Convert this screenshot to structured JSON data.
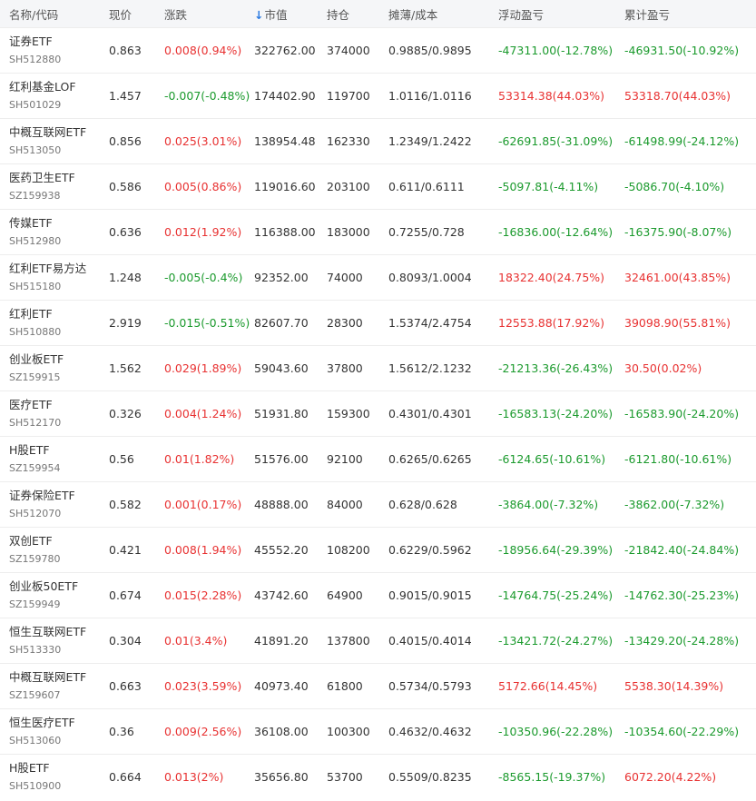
{
  "colors": {
    "up": "#e83232",
    "down": "#1b9a2d",
    "accent": "#2a7ae2"
  },
  "header": {
    "name_code": "名称/代码",
    "price": "现价",
    "change": "涨跌",
    "sort_icon": "arrow-down-icon",
    "sort_arrow": "↓",
    "market_value": "市值",
    "holding": "持仓",
    "cost": "摊薄/成本",
    "floating_pl": "浮动盈亏",
    "total_pl": "累计盈亏"
  },
  "rows": [
    {
      "name": "证券ETF",
      "code": "SH512880",
      "price": "0.863",
      "change": "0.008(0.94%)",
      "change_dir": "up",
      "mv": "322762.00",
      "hold": "374000",
      "cost": "0.9885/0.9895",
      "float": "-47311.00(-12.78%)",
      "float_dir": "down",
      "total": "-46931.50(-10.92%)",
      "total_dir": "down"
    },
    {
      "name": "红利基金LOF",
      "code": "SH501029",
      "price": "1.457",
      "change": "-0.007(-0.48%)",
      "change_dir": "down",
      "mv": "174402.90",
      "hold": "119700",
      "cost": "1.0116/1.0116",
      "float": "53314.38(44.03%)",
      "float_dir": "up",
      "total": "53318.70(44.03%)",
      "total_dir": "up"
    },
    {
      "name": "中概互联网ETF",
      "code": "SH513050",
      "price": "0.856",
      "change": "0.025(3.01%)",
      "change_dir": "up",
      "mv": "138954.48",
      "hold": "162330",
      "cost": "1.2349/1.2422",
      "float": "-62691.85(-31.09%)",
      "float_dir": "down",
      "total": "-61498.99(-24.12%)",
      "total_dir": "down"
    },
    {
      "name": "医药卫生ETF",
      "code": "SZ159938",
      "price": "0.586",
      "change": "0.005(0.86%)",
      "change_dir": "up",
      "mv": "119016.60",
      "hold": "203100",
      "cost": "0.611/0.6111",
      "float": "-5097.81(-4.11%)",
      "float_dir": "down",
      "total": "-5086.70(-4.10%)",
      "total_dir": "down"
    },
    {
      "name": "传媒ETF",
      "code": "SH512980",
      "price": "0.636",
      "change": "0.012(1.92%)",
      "change_dir": "up",
      "mv": "116388.00",
      "hold": "183000",
      "cost": "0.7255/0.728",
      "float": "-16836.00(-12.64%)",
      "float_dir": "down",
      "total": "-16375.90(-8.07%)",
      "total_dir": "down"
    },
    {
      "name": "红利ETF易方达",
      "code": "SH515180",
      "price": "1.248",
      "change": "-0.005(-0.4%)",
      "change_dir": "down",
      "mv": "92352.00",
      "hold": "74000",
      "cost": "0.8093/1.0004",
      "float": "18322.40(24.75%)",
      "float_dir": "up",
      "total": "32461.00(43.85%)",
      "total_dir": "up"
    },
    {
      "name": "红利ETF",
      "code": "SH510880",
      "price": "2.919",
      "change": "-0.015(-0.51%)",
      "change_dir": "down",
      "mv": "82607.70",
      "hold": "28300",
      "cost": "1.5374/2.4754",
      "float": "12553.88(17.92%)",
      "float_dir": "up",
      "total": "39098.90(55.81%)",
      "total_dir": "up"
    },
    {
      "name": "创业板ETF",
      "code": "SZ159915",
      "price": "1.562",
      "change": "0.029(1.89%)",
      "change_dir": "up",
      "mv": "59043.60",
      "hold": "37800",
      "cost": "1.5612/2.1232",
      "float": "-21213.36(-26.43%)",
      "float_dir": "down",
      "total": "30.50(0.02%)",
      "total_dir": "up"
    },
    {
      "name": "医疗ETF",
      "code": "SH512170",
      "price": "0.326",
      "change": "0.004(1.24%)",
      "change_dir": "up",
      "mv": "51931.80",
      "hold": "159300",
      "cost": "0.4301/0.4301",
      "float": "-16583.13(-24.20%)",
      "float_dir": "down",
      "total": "-16583.90(-24.20%)",
      "total_dir": "down"
    },
    {
      "name": "H股ETF",
      "code": "SZ159954",
      "price": "0.56",
      "change": "0.01(1.82%)",
      "change_dir": "up",
      "mv": "51576.00",
      "hold": "92100",
      "cost": "0.6265/0.6265",
      "float": "-6124.65(-10.61%)",
      "float_dir": "down",
      "total": "-6121.80(-10.61%)",
      "total_dir": "down"
    },
    {
      "name": "证券保险ETF",
      "code": "SH512070",
      "price": "0.582",
      "change": "0.001(0.17%)",
      "change_dir": "up",
      "mv": "48888.00",
      "hold": "84000",
      "cost": "0.628/0.628",
      "float": "-3864.00(-7.32%)",
      "float_dir": "down",
      "total": "-3862.00(-7.32%)",
      "total_dir": "down"
    },
    {
      "name": "双创ETF",
      "code": "SZ159780",
      "price": "0.421",
      "change": "0.008(1.94%)",
      "change_dir": "up",
      "mv": "45552.20",
      "hold": "108200",
      "cost": "0.6229/0.5962",
      "float": "-18956.64(-29.39%)",
      "float_dir": "down",
      "total": "-21842.40(-24.84%)",
      "total_dir": "down"
    },
    {
      "name": "创业板50ETF",
      "code": "SZ159949",
      "price": "0.674",
      "change": "0.015(2.28%)",
      "change_dir": "up",
      "mv": "43742.60",
      "hold": "64900",
      "cost": "0.9015/0.9015",
      "float": "-14764.75(-25.24%)",
      "float_dir": "down",
      "total": "-14762.30(-25.23%)",
      "total_dir": "down"
    },
    {
      "name": "恒生互联网ETF",
      "code": "SH513330",
      "price": "0.304",
      "change": "0.01(3.4%)",
      "change_dir": "up",
      "mv": "41891.20",
      "hold": "137800",
      "cost": "0.4015/0.4014",
      "float": "-13421.72(-24.27%)",
      "float_dir": "down",
      "total": "-13429.20(-24.28%)",
      "total_dir": "down"
    },
    {
      "name": "中概互联网ETF",
      "code": "SZ159607",
      "price": "0.663",
      "change": "0.023(3.59%)",
      "change_dir": "up",
      "mv": "40973.40",
      "hold": "61800",
      "cost": "0.5734/0.5793",
      "float": "5172.66(14.45%)",
      "float_dir": "up",
      "total": "5538.30(14.39%)",
      "total_dir": "up"
    },
    {
      "name": "恒生医疗ETF",
      "code": "SH513060",
      "price": "0.36",
      "change": "0.009(2.56%)",
      "change_dir": "up",
      "mv": "36108.00",
      "hold": "100300",
      "cost": "0.4632/0.4632",
      "float": "-10350.96(-22.28%)",
      "float_dir": "down",
      "total": "-10354.60(-22.29%)",
      "total_dir": "down"
    },
    {
      "name": "H股ETF",
      "code": "SH510900",
      "price": "0.664",
      "change": "0.013(2%)",
      "change_dir": "up",
      "mv": "35656.80",
      "hold": "53700",
      "cost": "0.5509/0.8235",
      "float": "-8565.15(-19.37%)",
      "float_dir": "down",
      "total": "6072.20(4.22%)",
      "total_dir": "up"
    }
  ]
}
